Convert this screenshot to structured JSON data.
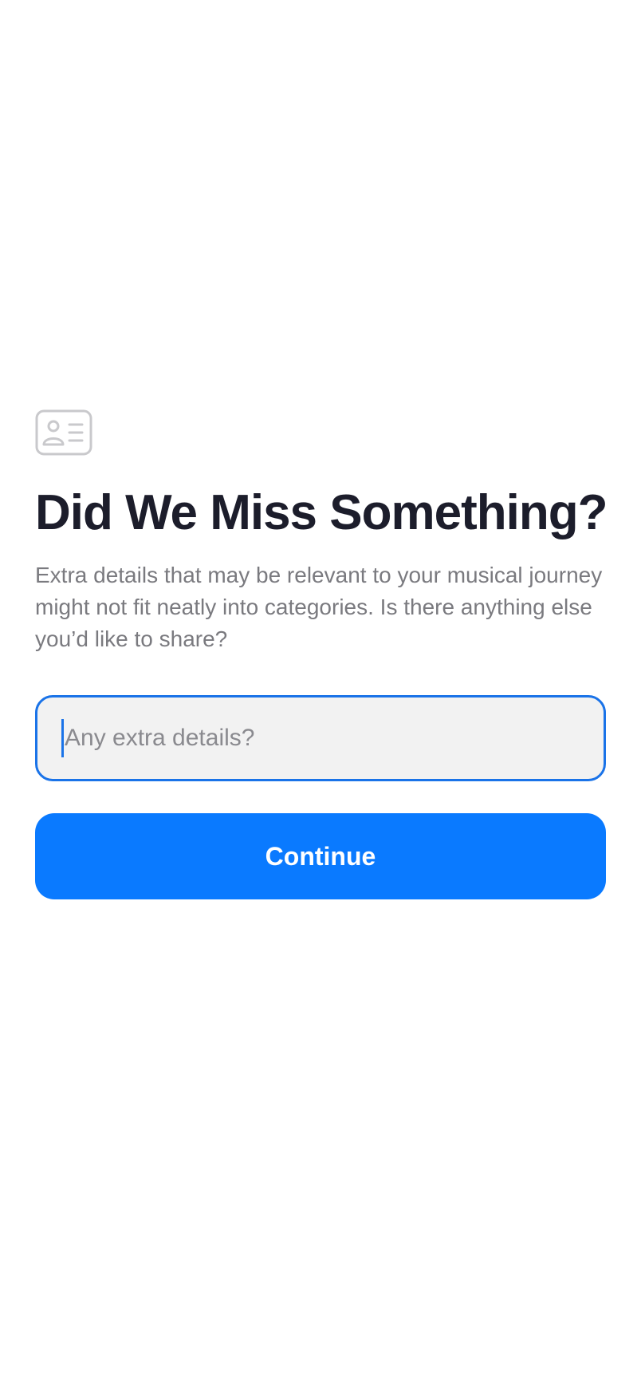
{
  "icon": "contact-card-icon",
  "colors": {
    "accent": "#0a7aff",
    "focus_border": "#1a73e8",
    "title": "#1c1d2b",
    "description": "#7a7a7f",
    "input_background": "#f2f2f2",
    "icon": "#c9c9cc"
  },
  "header": {
    "title": "Did We Miss Something?",
    "description": "Extra details that may be relevant to your musical journey might not fit neatly into categories. Is there anything else you’d like to share?"
  },
  "form": {
    "extra_details": {
      "value": "",
      "placeholder": "Any extra details?"
    },
    "continue_label": "Continue"
  }
}
